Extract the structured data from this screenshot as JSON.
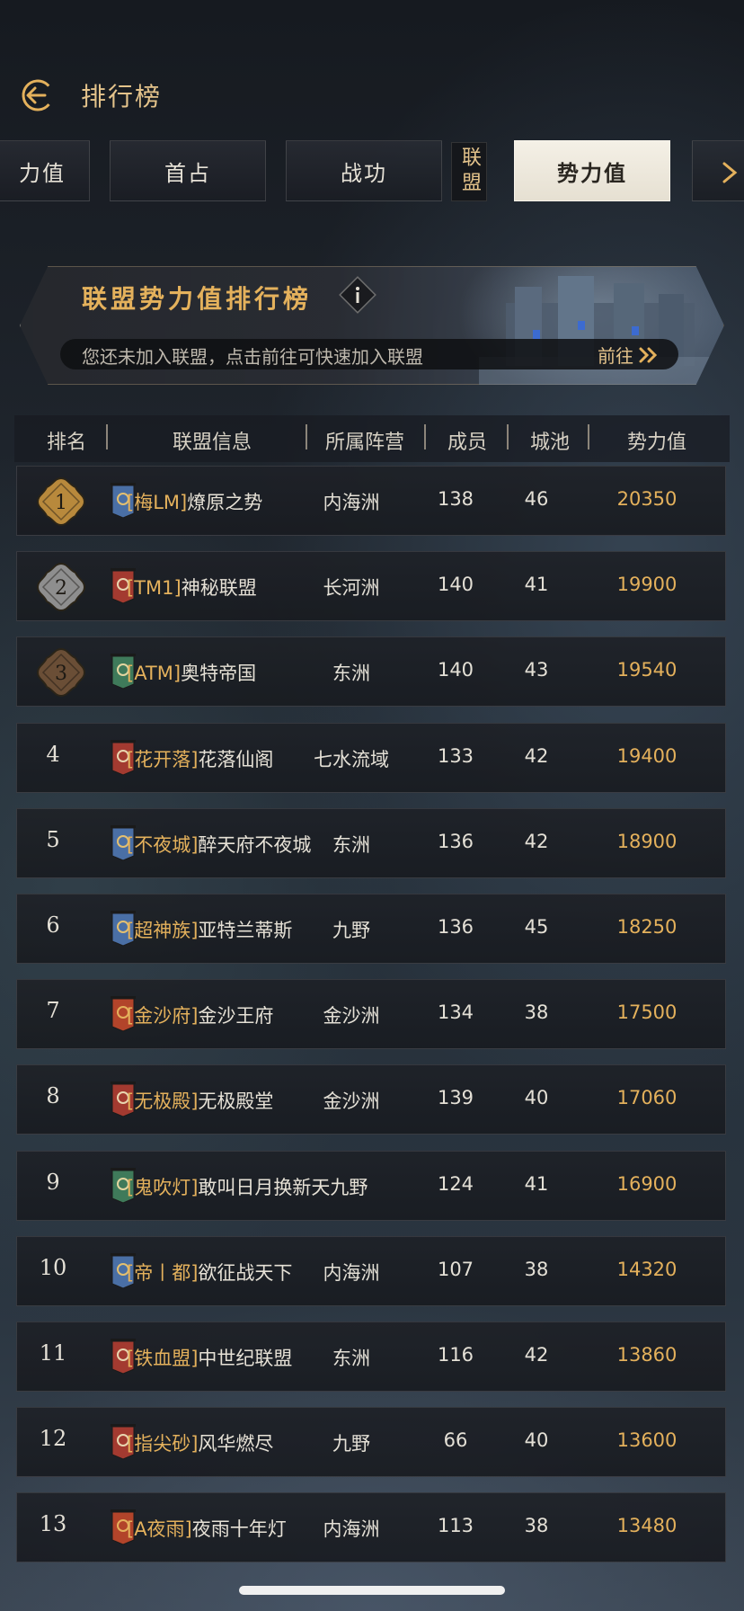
{
  "header": {
    "title": "排行榜",
    "back_icon": "back-arrow-icon"
  },
  "tabs": [
    {
      "label": "力值",
      "active": false
    },
    {
      "label": "首占",
      "active": false
    },
    {
      "label": "战功",
      "active": false
    },
    {
      "label": "联盟",
      "active": false,
      "vertical": true
    },
    {
      "label": "势力值",
      "active": true
    }
  ],
  "banner": {
    "title": "联盟势力值排行榜",
    "info_icon": "info-icon",
    "notice": "您还未加入联盟，点击前往可快速加入联盟",
    "goto_label": "前往"
  },
  "table": {
    "columns": [
      "排名",
      "联盟信息",
      "所属阵营",
      "成员",
      "城池",
      "势力值"
    ],
    "rows": [
      {
        "rank": "1",
        "tag": "[梅LM]",
        "name": "燎原之势",
        "camp": "内海洲",
        "members": "138",
        "cities": "46",
        "power": "20350",
        "flag": "blue-horse"
      },
      {
        "rank": "2",
        "tag": "[TM1]",
        "name": "神秘联盟",
        "camp": "长河洲",
        "members": "140",
        "cities": "41",
        "power": "19900",
        "flag": "red-dragon"
      },
      {
        "rank": "3",
        "tag": "[ATM]",
        "name": "奥特帝国",
        "camp": "东洲",
        "members": "140",
        "cities": "43",
        "power": "19540",
        "flag": "green-bird"
      },
      {
        "rank": "4",
        "tag": "[花开落]",
        "name": "花落仙阁",
        "camp": "七水流域",
        "members": "133",
        "cities": "42",
        "power": "19400",
        "flag": "red-dragon"
      },
      {
        "rank": "5",
        "tag": "[不夜城]",
        "name": "醉天府不夜城",
        "camp": "东洲",
        "members": "136",
        "cities": "42",
        "power": "18900",
        "flag": "blue-horse"
      },
      {
        "rank": "6",
        "tag": "[超神族]",
        "name": "亚特兰蒂斯",
        "camp": "九野",
        "members": "136",
        "cities": "45",
        "power": "18250",
        "flag": "blue-horse"
      },
      {
        "rank": "7",
        "tag": "[金沙府]",
        "name": "金沙王府",
        "camp": "金沙洲",
        "members": "134",
        "cities": "38",
        "power": "17500",
        "flag": "red-ring"
      },
      {
        "rank": "8",
        "tag": "[无极殿]",
        "name": "无极殿堂",
        "camp": "金沙洲",
        "members": "139",
        "cities": "40",
        "power": "17060",
        "flag": "red-dragon"
      },
      {
        "rank": "9",
        "tag": "[鬼吹灯]",
        "name": "敢叫日月换新天九野",
        "camp": "",
        "members": "124",
        "cities": "41",
        "power": "16900",
        "flag": "green-bird"
      },
      {
        "rank": "10",
        "tag": "[帝丨都]",
        "name": "欲征战天下",
        "camp": "内海洲",
        "members": "107",
        "cities": "38",
        "power": "14320",
        "flag": "blue-horse"
      },
      {
        "rank": "11",
        "tag": "[铁血盟]",
        "name": "中世纪联盟",
        "camp": "东洲",
        "members": "116",
        "cities": "42",
        "power": "13860",
        "flag": "red-dragon"
      },
      {
        "rank": "12",
        "tag": "[指尖砂]",
        "name": "风华燃尽",
        "camp": "九野",
        "members": "66",
        "cities": "40",
        "power": "13600",
        "flag": "red-dragon"
      },
      {
        "rank": "13",
        "tag": "[A夜雨]",
        "name": "夜雨十年灯",
        "camp": "内海洲",
        "members": "113",
        "cities": "38",
        "power": "13480",
        "flag": "red-ring"
      }
    ]
  },
  "colors": {
    "gold": "#e4b15c",
    "badge_gold": "#b8893c",
    "badge_silver": "#8e8e8e",
    "badge_bronze": "#6a4e36"
  }
}
